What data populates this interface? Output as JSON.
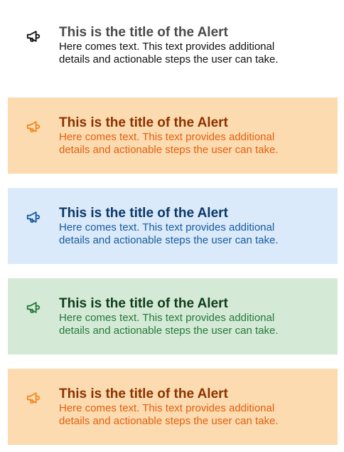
{
  "alerts": [
    {
      "variant": "default",
      "icon": "megaphone-icon",
      "title": "This is the title of the Alert",
      "text": "Here comes text. This text provides additional details and actionable steps the user can take."
    },
    {
      "variant": "warning",
      "icon": "megaphone-icon",
      "title": "This is the title of the Alert",
      "text": "Here comes text. This text provides additional details and actionable steps the user can take."
    },
    {
      "variant": "info",
      "icon": "megaphone-icon",
      "title": "This is the title of the Alert",
      "text": "Here comes text. This text provides additional details and actionable steps the user can take."
    },
    {
      "variant": "success",
      "icon": "megaphone-icon",
      "title": "This is the title of the Alert",
      "text": "Here comes text. This text provides additional details and actionable steps the user can take."
    },
    {
      "variant": "warning",
      "icon": "megaphone-icon",
      "title": "This is the title of the Alert",
      "text": "Here comes text. This text provides additional details and actionable steps the user can take."
    }
  ],
  "colors": {
    "default_bg": "#ffffff",
    "warning_bg": "#fddbb0",
    "info_bg": "#dbeafa",
    "success_bg": "#d5ead6"
  }
}
